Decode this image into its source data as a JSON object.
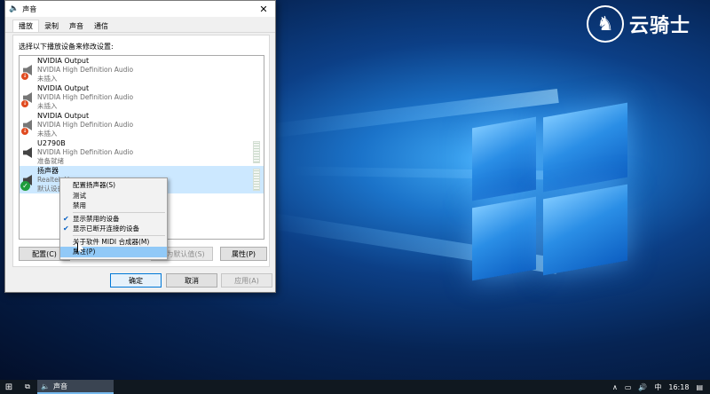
{
  "brand": {
    "logo_icon": "horse-rider-icon",
    "text": "云骑士"
  },
  "dialog": {
    "title": "声音",
    "close_glyph": "✕",
    "tabs": [
      {
        "label": "播放"
      },
      {
        "label": "录制"
      },
      {
        "label": "声音"
      },
      {
        "label": "通信"
      }
    ],
    "instruction": "选择以下播放设备来修改设置:",
    "devices": [
      {
        "name": "NVIDIA Output",
        "driver": "NVIDIA High Definition Audio",
        "status": "未插入"
      },
      {
        "name": "NVIDIA Output",
        "driver": "NVIDIA High Definition Audio",
        "status": "未插入"
      },
      {
        "name": "NVIDIA Output",
        "driver": "NVIDIA High Definition Audio",
        "status": "未插入"
      },
      {
        "name": "U2790B",
        "driver": "NVIDIA High Definition Audio",
        "status": "准备就绪"
      },
      {
        "name": "扬声器",
        "driver": "Realtek H",
        "status": "默认设备"
      }
    ],
    "buttons": {
      "configure": "配置(C)",
      "set_default": "设为默认值(S)",
      "properties": "属性(P)",
      "ok": "确定",
      "cancel": "取消",
      "apply": "应用(A)"
    }
  },
  "context_menu": {
    "items": [
      {
        "label": "配置扬声器(S)"
      },
      {
        "label": "测试"
      },
      {
        "label": "禁用"
      },
      {
        "label": "显示禁用的设备",
        "checked": true
      },
      {
        "label": "显示已断开连接的设备",
        "checked": true
      },
      {
        "label": "关于软件 MIDI 合成器(M)"
      },
      {
        "label": "属性(P)",
        "highlighted": true
      }
    ]
  },
  "taskbar": {
    "app_label": "声音",
    "ime": "中",
    "time": "16:18"
  }
}
